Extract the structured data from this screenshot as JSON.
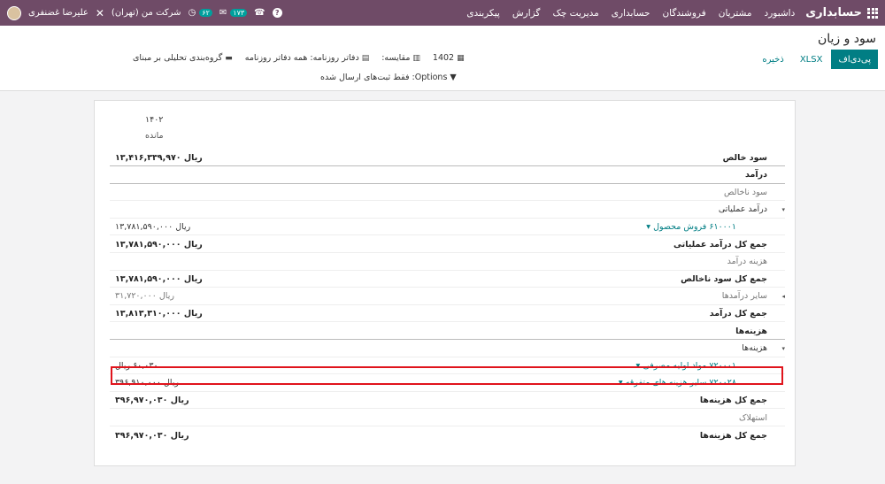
{
  "topbar": {
    "brand": "حسابداری",
    "menu": [
      "داشبورد",
      "مشتریان",
      "فروشندگان",
      "حسابداری",
      "مدیریت چک",
      "گزارش",
      "پیکربندی"
    ],
    "user": "علیرضا غضنفری",
    "company": "شرکت من (تهران)",
    "activity_count": "۶۲",
    "messages_count": "۱۷۳"
  },
  "page": {
    "title": "سود و زیان",
    "btn_pdf": "پی‌دی‌اف",
    "btn_xlsx": "XLSX",
    "btn_save": "ذخیره",
    "filter_period": "1402",
    "filter_compare": "مقایسه:",
    "filter_journals": "دفاتر روزنامه: همه دفاتر روزنامه",
    "filter_group": "گروه‌بندی تحلیلی بر مبنای",
    "options": "Options: فقط ثبت‌های ارسال شده"
  },
  "report": {
    "col_year": "۱۴۰۲",
    "col_balance": "مانده",
    "rows": [
      {
        "label": "سود خالص",
        "value": "ریال ۱۳,۴۱۶,۳۳۹,۹۷۰",
        "style": "bold",
        "border": "dark"
      },
      {
        "label": "درآمد",
        "value": "",
        "style": "bold",
        "border": "dark"
      },
      {
        "label": "سود ناخالص",
        "value": "",
        "style": "muted",
        "border": "light"
      },
      {
        "label": "درآمد عملیاتی",
        "value": "",
        "style": "normal",
        "border": "light",
        "caret": "▾"
      },
      {
        "label": "۶۱۰۰۰۱ فروش محصول ▾",
        "value": "ریال ۱۳,۷۸۱,۵۹۰,۰۰۰",
        "style": "link",
        "border": "light"
      },
      {
        "label": "جمع کل درآمد عملیاتی",
        "value": "ریال ۱۳,۷۸۱,۵۹۰,۰۰۰",
        "style": "bold",
        "border": "light"
      },
      {
        "label": "هزینه درآمد",
        "value": "",
        "style": "muted",
        "border": "light"
      },
      {
        "label": "جمع کل سود ناخالص",
        "value": "ریال ۱۳,۷۸۱,۵۹۰,۰۰۰",
        "style": "bold",
        "border": "light"
      },
      {
        "label": "سایر درآمدها",
        "value": "ریال ۳۱,۷۲۰,۰۰۰",
        "style": "muted",
        "border": "light",
        "caret": "◂"
      },
      {
        "label": "جمع کل درآمد",
        "value": "ریال ۱۳,۸۱۳,۳۱۰,۰۰۰",
        "style": "bold",
        "border": "light"
      },
      {
        "label": "هزینه‌ها",
        "value": "",
        "style": "bold",
        "border": "dark"
      },
      {
        "label": "هزینه‌ها",
        "value": "",
        "style": "normal",
        "border": "light",
        "caret": "▾"
      },
      {
        "label": "۷۲۰۰۰۱ مواد اولیه مصرفی ▾",
        "value": "۶۰,۰۳۰ ریال",
        "style": "link",
        "border": "light"
      },
      {
        "label": "۷۲۰۰۲۸ سایر هزینه های متفرقه ▾",
        "value": "ریال ۳۹۶,۹۱۰,۰۰۰",
        "style": "link",
        "border": "light"
      },
      {
        "label": "جمع کل هزینه‌ها",
        "value": "ریال ۳۹۶,۹۷۰,۰۳۰",
        "style": "bold",
        "border": "light"
      },
      {
        "label": "استهلاک",
        "value": "",
        "style": "muted",
        "border": "light"
      },
      {
        "label": "جمع کل هزینه‌ها",
        "value": "ریال ۳۹۶,۹۷۰,۰۳۰",
        "style": "bold",
        "border": "none"
      }
    ]
  }
}
